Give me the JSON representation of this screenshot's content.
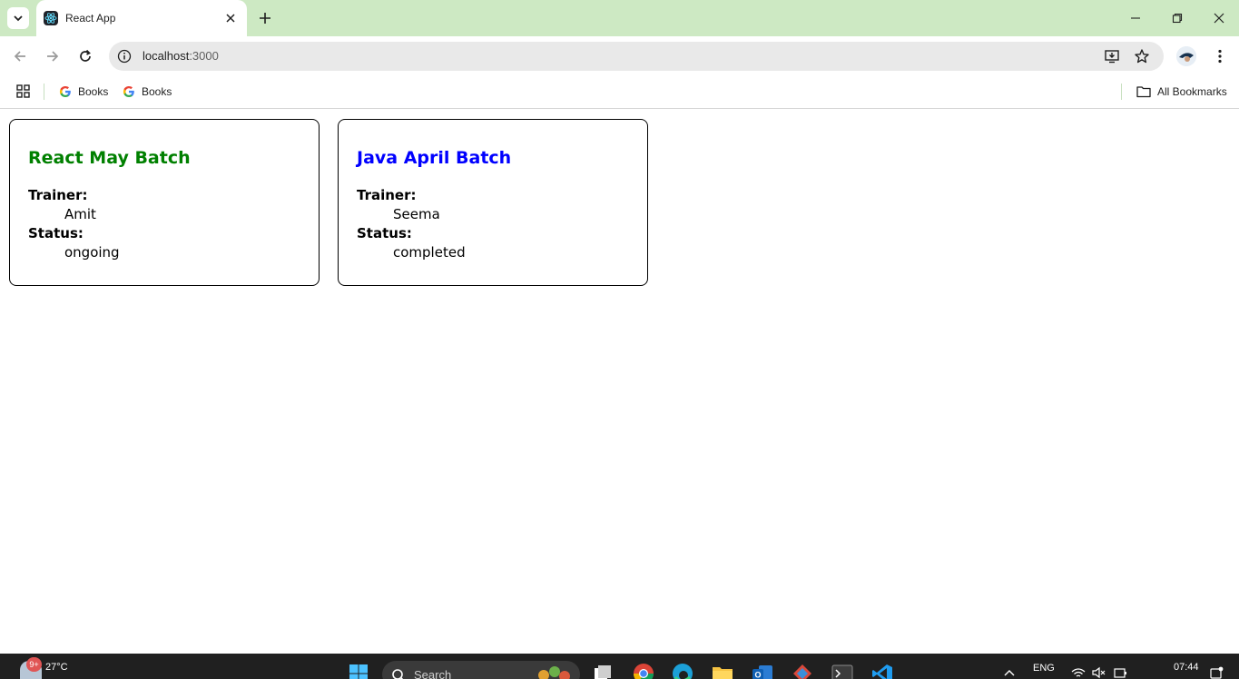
{
  "browser": {
    "tab_title": "React App",
    "url_host": "localhost",
    "url_port": ":3000",
    "icons": {
      "tab_search": "chevron-down-icon",
      "favicon": "react-logo-icon",
      "tab_close": "close-icon",
      "new_tab": "plus-icon",
      "minimize": "minimize-icon",
      "maximize": "restore-icon",
      "close_window": "close-icon",
      "back": "back-arrow-icon",
      "forward": "forward-arrow-icon",
      "reload": "reload-icon",
      "site_info": "info-icon",
      "install": "install-app-icon",
      "bookmark": "star-icon",
      "menu": "kebab-menu-icon"
    }
  },
  "bookmarks": {
    "items": [
      {
        "label": "Books",
        "icon": "google-icon"
      },
      {
        "label": "Books",
        "icon": "google-icon"
      }
    ],
    "all_bookmarks_label": "All Bookmarks"
  },
  "cards": [
    {
      "title": "React May Batch",
      "title_color": "#008000",
      "trainer_label": "Trainer:",
      "trainer": "Amit",
      "status_label": "Status:",
      "status": "ongoing"
    },
    {
      "title": "Java April Batch",
      "title_color": "#0000ff",
      "trainer_label": "Trainer:",
      "trainer": "Seema",
      "status_label": "Status:",
      "status": "completed"
    }
  ],
  "taskbar": {
    "weather_badge": "9+",
    "temperature": "27°C",
    "search_label": "Search",
    "language": "ENG",
    "time": "07:44"
  },
  "colors": {
    "tabstrip": "#cde9c3",
    "omnibox": "#e9e9e9",
    "taskbar": "#202020"
  }
}
